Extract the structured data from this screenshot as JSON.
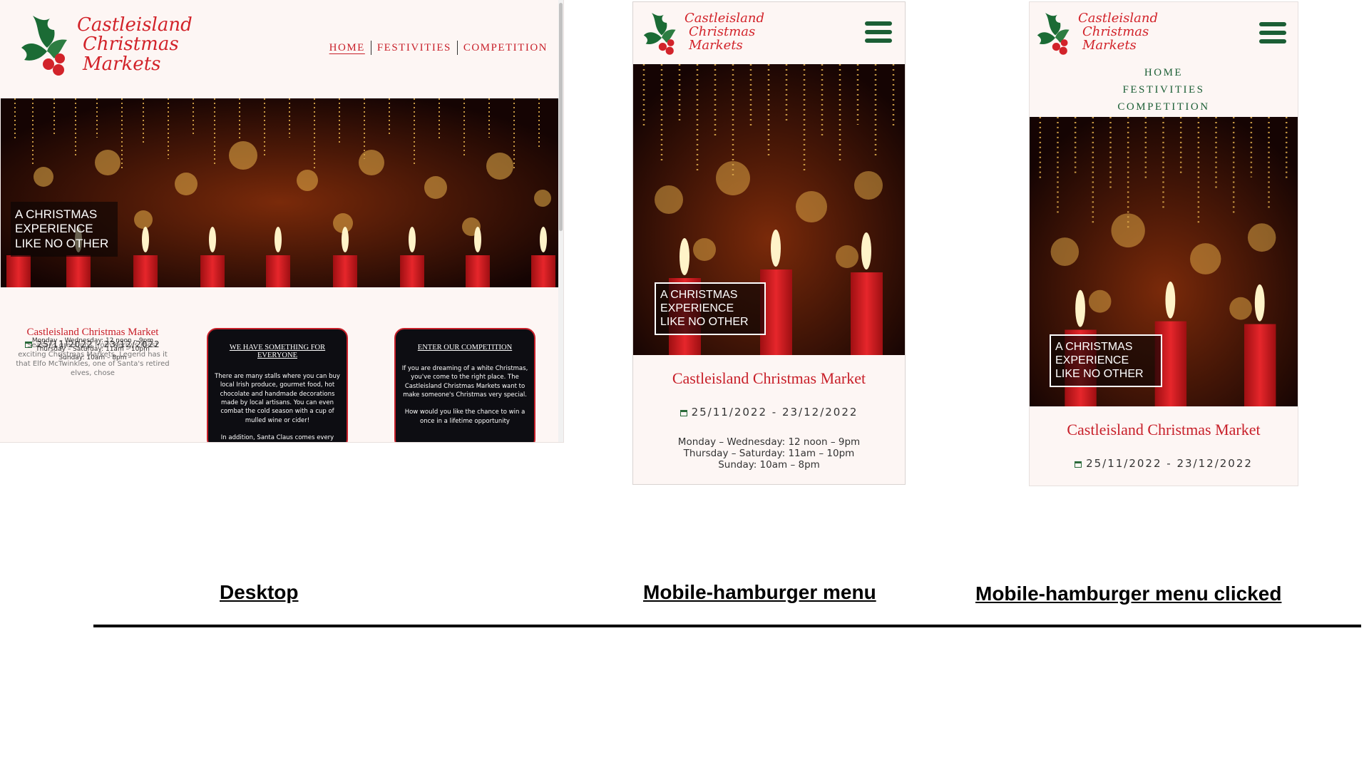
{
  "brand": {
    "line1": "Castleisland",
    "line2": "Christmas",
    "line3": "Markets"
  },
  "desktop": {
    "nav": [
      "HOME",
      "FESTIVITIES",
      "COMPETITION"
    ],
    "hero_caption": "A CHRISTMAS EXPERIENCE LIKE NO OTHER",
    "market": {
      "title": "Castleisland Christmas Market",
      "dates": "25/11/2022 - 23/12/2022",
      "hours": [
        "Monday – Wednesday: 12 noon – 9pm",
        "Thursday – Saturday: 11am – 10pm",
        "Sunday: 10am – 8pm"
      ],
      "intro": "Seasons greetings from Kerry's most exciting Christmas Markets. Legend has it that Elfo McTwinkles, one of Santa's retired elves, chose"
    },
    "card1": {
      "title": "WE HAVE SOMETHING FOR EVERYONE",
      "body": "There are many stalls where you can buy local Irish produce, gourmet food, hot chocolate and handmade decorations made by local artisans. You can even combat the cold season with a cup of mulled wine or cider!",
      "body2": "In addition, Santa Claus comes every"
    },
    "card2": {
      "title": "ENTER OUR COMPETITION",
      "body": "If you are dreaming of a white Christmas, you've come to the right place. The Castleisland Christmas Markets want to make someone's Christmas very special.",
      "body2": "How would you like the chance to win a once in a lifetime opportunity"
    }
  },
  "mobile": {
    "hero_caption": "A CHRISTMAS EXPERIENCE LIKE NO OTHER",
    "title": "Castleisland Christmas Market",
    "dates": "25/11/2022 - 23/12/2022",
    "hours": [
      "Monday – Wednesday: 12 noon – 9pm",
      "Thursday – Saturday: 11am – 10pm",
      "Sunday: 10am – 8pm"
    ]
  },
  "mobile_clicked": {
    "menu": [
      "HOME",
      "FESTIVITIES",
      "COMPETITION"
    ],
    "hero_caption": "A CHRISTMAS EXPERIENCE LIKE NO OTHER",
    "title": "Castleisland Christmas Market",
    "dates": "25/11/2022 - 23/12/2022"
  },
  "labels": {
    "desktop": "Desktop",
    "mobile": "Mobile-hamburger menu",
    "clicked": "Mobile-hamburger menu clicked"
  },
  "colors": {
    "brand_red": "#c8202a",
    "holly_green": "#1b5e35",
    "page_bg": "#fdf6f4"
  },
  "icons": [
    "holly-logo-icon",
    "hamburger-icon",
    "calendar-icon"
  ]
}
